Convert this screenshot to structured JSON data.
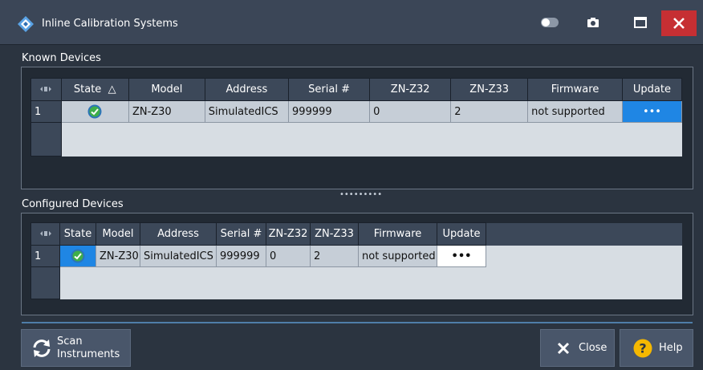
{
  "window": {
    "title": "Inline Calibration Systems"
  },
  "known": {
    "label": "Known Devices",
    "columns": [
      "State",
      "Model",
      "Address",
      "Serial #",
      "ZN-Z32",
      "ZN-Z33",
      "Firmware",
      "Update"
    ],
    "sort_indicator": "△",
    "rows": [
      {
        "num": "1",
        "model": "ZN-Z30",
        "address": "SimulatedICS",
        "serial": "999999",
        "z32": "0",
        "z33": "2",
        "firmware": "not supported",
        "update": "•••"
      }
    ]
  },
  "splitter": {
    "label": "•••••••••"
  },
  "configured": {
    "label": "Configured Devices",
    "columns": [
      "State",
      "Model",
      "Address",
      "Serial #",
      "ZN-Z32",
      "ZN-Z33",
      "Firmware",
      "Update"
    ],
    "rows": [
      {
        "num": "1",
        "model": "ZN-Z30",
        "address": "SimulatedICS",
        "serial": "999999",
        "z32": "0",
        "z33": "2",
        "firmware": "not supported",
        "update": "•••"
      }
    ]
  },
  "buttons": {
    "scan_line1": "Scan",
    "scan_line2": "Instruments",
    "close": "Close",
    "help": "Help"
  },
  "colors": {
    "titlebar": "#3b4657",
    "close_red": "#c62f33",
    "selection_blue": "#1f86e4",
    "background": "#2b3440"
  },
  "icons": {
    "app": "rs-logo-icon",
    "toggle": "toggle-icon",
    "camera": "camera-icon",
    "maximize": "maximize-icon",
    "close": "close-icon",
    "state_ok": "check-circle-icon",
    "refresh": "refresh-icon",
    "help": "question-icon"
  }
}
